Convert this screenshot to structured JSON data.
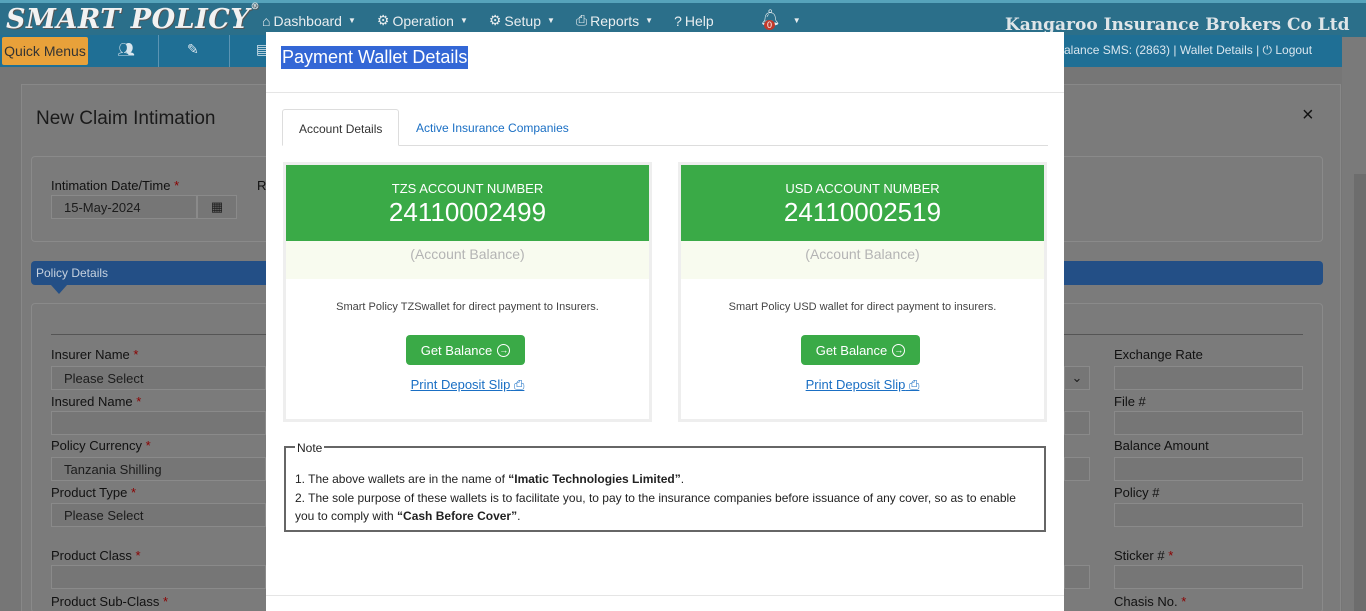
{
  "app": {
    "logo": "SMART POLICY",
    "registered": "®",
    "company": "Kangaroo Insurance Brokers Co Ltd"
  },
  "nav": {
    "items": [
      {
        "icon": "home-icon",
        "glyph": "⌂",
        "label": "Dashboard",
        "caret": "▼"
      },
      {
        "icon": "cogs-icon",
        "glyph": "⚙",
        "label": "Operation",
        "caret": "▼"
      },
      {
        "icon": "gear-icon",
        "glyph": "⚙",
        "label": "Setup",
        "caret": "▼"
      },
      {
        "icon": "print-icon",
        "glyph": "⎙",
        "label": "Reports",
        "caret": "▼"
      },
      {
        "icon": "question-icon",
        "glyph": "?",
        "label": "Help",
        "caret": ""
      }
    ],
    "bell_count": "0"
  },
  "toolbar": {
    "quick_menus": "Quick Menus",
    "sms_text": "alance SMS: (2863)  |  Wallet Details |  ⏻ Logout"
  },
  "background_form": {
    "title": "New Claim Intimation",
    "close": "×",
    "intimation_label": "Intimation Date/Time",
    "intimation_value": "15-May-2024",
    "r_label": "R",
    "policy_details": "Policy Details",
    "left_fields": [
      {
        "label": "Insurer Name",
        "required": true,
        "value": "Please Select"
      },
      {
        "label": "Insured Name",
        "required": true,
        "value": ""
      },
      {
        "label": "Policy Currency",
        "required": true,
        "value": "Tanzania Shilling"
      },
      {
        "label": "Product Type",
        "required": true,
        "value": "Please Select"
      },
      {
        "label": "Product Class",
        "required": true,
        "value": ""
      },
      {
        "label": "Product Sub-Class",
        "required": true,
        "value": ""
      }
    ],
    "right_fields": [
      {
        "label": "Exchange Rate",
        "required": false
      },
      {
        "label": "File #",
        "required": false
      },
      {
        "label": "Balance Amount",
        "required": false
      },
      {
        "label": "Policy #",
        "required": false
      },
      {
        "label": "Sticker #",
        "required": true
      },
      {
        "label": "Chasis No.",
        "required": true
      }
    ]
  },
  "modal": {
    "title": "Payment Wallet Details",
    "tabs": [
      "Account Details",
      "Active Insurance Companies"
    ],
    "accounts": [
      {
        "heading": "TZS ACCOUNT NUMBER",
        "number": "24110002499",
        "balance": "(Account Balance)",
        "description": "Smart Policy TZSwallet for direct payment to Insurers.",
        "button": "Get Balance",
        "slip": "Print Deposit Slip"
      },
      {
        "heading": "USD ACCOUNT NUMBER",
        "number": "24110002519",
        "balance": "(Account Balance)",
        "description": "Smart Policy USD wallet for direct payment to insurers.",
        "button": "Get Balance",
        "slip": "Print Deposit Slip"
      }
    ],
    "note": {
      "legend": "Note",
      "line1_prefix": "1. The above wallets are in the name of ",
      "line1_bold": "“Imatic Technologies Limited”",
      "line1_suffix": ".",
      "line2_prefix": "2. The sole purpose of these wallets is to facilitate you, to pay to the insurance companies before issuance of any cover, so as to enable you to comply with ",
      "line2_bold": "“Cash Before Cover”",
      "line2_suffix": "."
    }
  },
  "colors": {
    "nav_bg": "#2b6f8a",
    "green": "#3aaa47",
    "link": "#1a6fc4",
    "title_highlight": "#3367d6"
  }
}
